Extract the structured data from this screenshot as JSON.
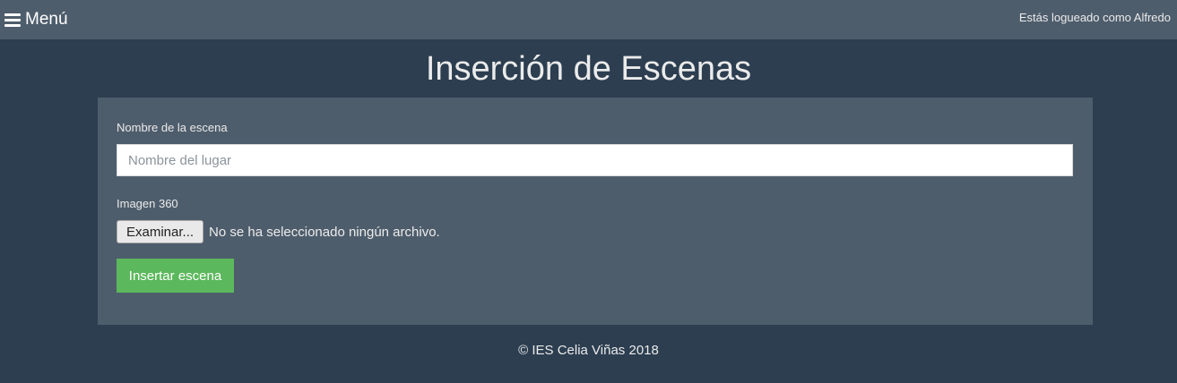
{
  "header": {
    "menu_label": "Menú",
    "menu_icon": "hamburger-icon",
    "user_status": "Estás logueado como Alfredo"
  },
  "page": {
    "title": "Inserción de Escenas"
  },
  "form": {
    "name_label": "Nombre de la escena",
    "name_placeholder": "Nombre del lugar",
    "name_value": "",
    "image_label": "Imagen 360",
    "file_button_label": "Examinar...",
    "file_status": "No se ha seleccionado ningún archivo.",
    "submit_label": "Insertar escena"
  },
  "footer": {
    "text": "© IES Celia Viñas 2018"
  },
  "colors": {
    "background": "#2c3e50",
    "panel": "#4e5d6c",
    "submit": "#5cb85c"
  }
}
